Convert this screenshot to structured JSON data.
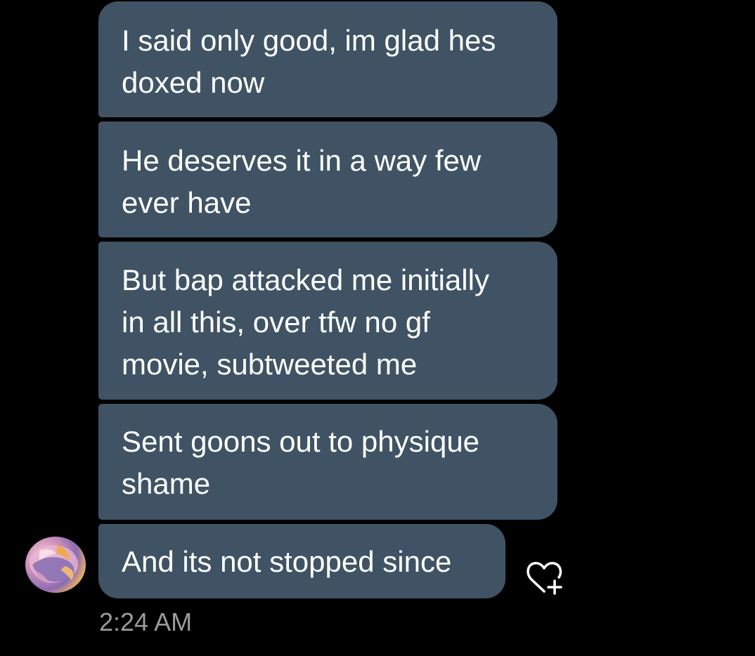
{
  "messages": [
    {
      "text": "I said only good, im glad hes\ndoxed now"
    },
    {
      "text": "He deserves it in a way few\never have"
    },
    {
      "text": "But bap attacked me initially\nin all this, over tfw no gf\nmovie, subtweeted me"
    },
    {
      "text": "Sent goons out to physique\nshame"
    },
    {
      "text": "And its not stopped since"
    }
  ],
  "timestamp": "2:24 AM",
  "icons": {
    "avatar": "sender-avatar",
    "react": "heart-plus-icon"
  },
  "colors": {
    "background": "#000000",
    "bubble": "#3f5364",
    "text": "#ffffff",
    "timestamp": "#9a9a9a"
  }
}
